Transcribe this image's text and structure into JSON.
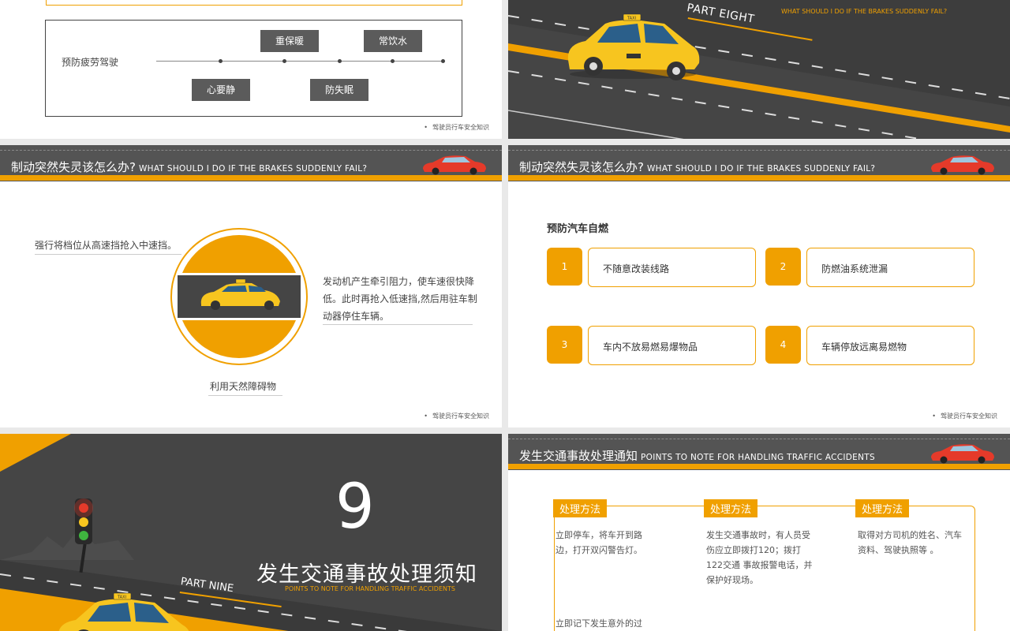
{
  "slide1": {
    "label": "预防疲劳驾驶",
    "items_top": [
      "重保暖",
      "常饮水"
    ],
    "items_bottom": [
      "心要静",
      "防失眠"
    ],
    "footer": "驾驶员行车安全知识"
  },
  "slide2": {
    "part": "PART EIGHT",
    "subtitle_en": "WHAT SHOULD I DO IF THE BRAKES SUDDENLY FAIL?",
    "taxi_sign": "TAXI"
  },
  "slide3": {
    "header_cn": "制动突然失灵该怎么办?",
    "header_en": "WHAT SHOULD I DO IF THE BRAKES SUDDENLY FAIL?",
    "left_text": "强行将档位从高速挡抢入中速挡。",
    "right_text": "发动机产生牵引阻力，使车速很快降低。此时再抢入低速挡,然后用驻车制动器停住车辆。",
    "bottom_text": "利用天然障碍物",
    "footer": "驾驶员行车安全知识"
  },
  "slide4": {
    "header_cn": "制动突然失灵该怎么办?",
    "header_en": "WHAT SHOULD I DO IF THE BRAKES SUDDENLY FAIL?",
    "title": "预防汽车自燃",
    "items": [
      {
        "num": "1",
        "text": "不随意改装线路"
      },
      {
        "num": "2",
        "text": "防燃油系统泄漏"
      },
      {
        "num": "3",
        "text": "车内不放易燃易爆物品"
      },
      {
        "num": "4",
        "text": "车辆停放远离易燃物"
      }
    ],
    "footer": "驾驶员行车安全知识"
  },
  "slide5": {
    "number": "9",
    "title": "发生交通事故处理须知",
    "part": "PART NINE",
    "subtitle_en": "POINTS TO NOTE FOR HANDLING TRAFFIC ACCIDENTS",
    "taxi_sign": "TAXI"
  },
  "slide6": {
    "header_cn": "发生交通事故处理通知",
    "header_en": "POINTS TO NOTE FOR HANDLING TRAFFIC ACCIDENTS",
    "columns": [
      {
        "tag": "处理方法",
        "text": "立即停车，将车开到路边，打开双闪警告灯。"
      },
      {
        "tag": "处理方法",
        "text": "发生交通事故时，有人员受伤应立即拨打120；拨打122交通  事故报警电话，并保护好现场。"
      },
      {
        "tag": "处理方法",
        "text": "取得对方司机的姓名、汽车资料、驾驶执照等 。"
      }
    ],
    "bottom_text": "立即记下发生意外的过"
  },
  "colors": {
    "accent": "#f0a000",
    "dark": "#454545",
    "header": "#545454"
  }
}
